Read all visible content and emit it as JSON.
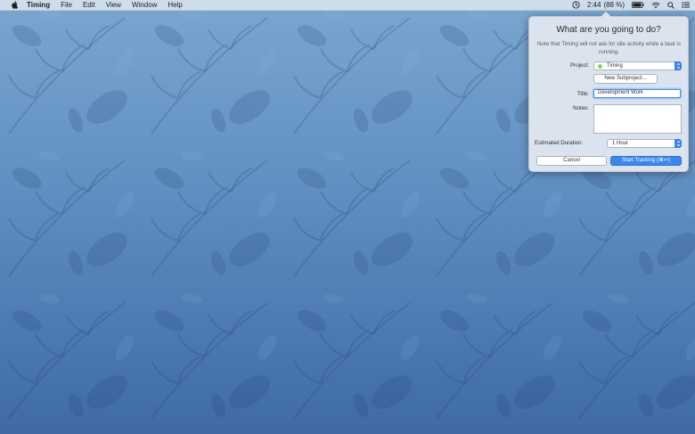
{
  "menubar": {
    "app_name": "Timing",
    "items": [
      "File",
      "Edit",
      "View",
      "Window",
      "Help"
    ],
    "status": {
      "clock": "2:44",
      "battery": "(88 %)"
    }
  },
  "dialog": {
    "title": "What are you going to do?",
    "note": "Note that Timing will not ask for idle activity while a task is running.",
    "project_label": "Project:",
    "project_value": "Timing",
    "project_color": "#8fd05b",
    "new_subproject_label": "New Subproject...",
    "title_label": "Title:",
    "title_value": "Development Work",
    "notes_label": "Notes:",
    "notes_value": "",
    "duration_label": "Estimated Duration:",
    "duration_value": "1 Hour",
    "cancel_label": "Cancel",
    "start_label": "Start Tracking (⌘↩)"
  },
  "colors": {
    "accent": "#3d86ee",
    "wallpaper_top": "#7aa6cf",
    "wallpaper_bottom": "#3f6aa6"
  }
}
